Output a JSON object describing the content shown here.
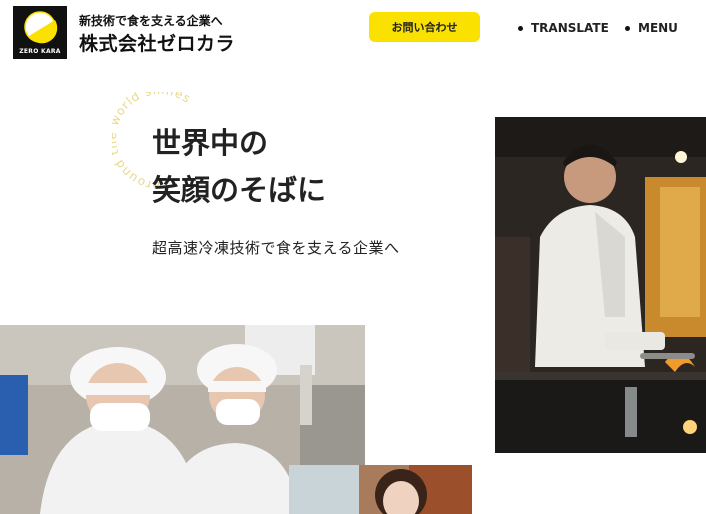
{
  "header": {
    "logo_mark": "ZERO KARA",
    "tagline": "新技術で食を支える企業へ",
    "company_name": "株式会社ゼロカラ",
    "contact_button": "お問い合わせ",
    "translate_label": "TRANSLATE",
    "menu_label": "MENU"
  },
  "hero": {
    "circle_text": "around the world smiles",
    "headline_line1": "世界中の",
    "headline_line2": "笑顔のそばに",
    "subheadline": "超高速冷凍技術で食を支える企業へ"
  },
  "colors": {
    "accent_yellow": "#fbe100",
    "logo_background": "#111111",
    "text": "#222222"
  }
}
